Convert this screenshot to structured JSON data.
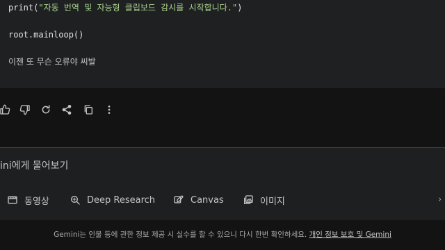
{
  "message": {
    "code_print_prefix": "print(",
    "code_print_string": "\"자동 번역 및 자능형 클립보드 감시를 시작합니다.\"",
    "code_print_suffix": ")",
    "code_mainloop": "root.mainloop()",
    "user_text": "이젠 또 무슨 오류야 씨발"
  },
  "actions": {
    "icons": [
      "thumbs-up-icon",
      "thumbs-down-icon",
      "refresh-icon",
      "share-icon",
      "copy-icon",
      "more-vert-icon"
    ]
  },
  "composer": {
    "prompt_text": "ini에게 물어보기",
    "tools": [
      {
        "icon": "video-icon",
        "label": "동영상"
      },
      {
        "icon": "deep-research-icon",
        "label": "Deep Research"
      },
      {
        "icon": "canvas-icon",
        "label": "Canvas"
      },
      {
        "icon": "image-icon",
        "label": "이미지"
      }
    ]
  },
  "footer": {
    "disclaimer": "Gemini는 인물 등에 관한 정보 제공 시 실수를 할 수 있으니 다시 한번 확인하세요.",
    "link": "개인 정보 보호 및 Gemini"
  },
  "colors": {
    "background": "#131314",
    "bubble": "#1f2022",
    "string_green": "#a8d28d",
    "text": "#c4c7c5"
  }
}
